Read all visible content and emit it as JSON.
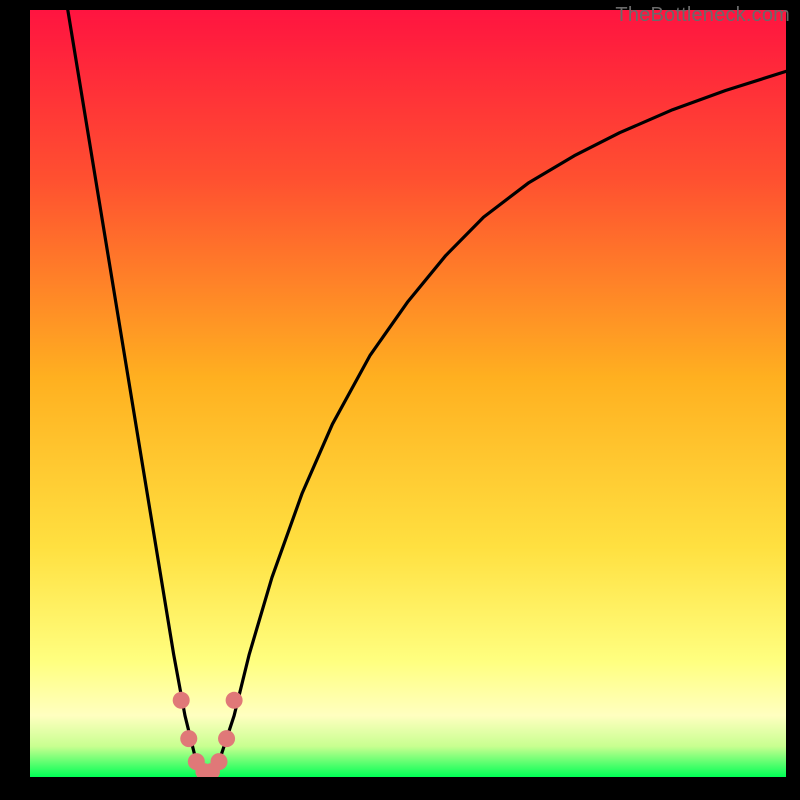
{
  "watermark": "TheBottleneck.com",
  "colors": {
    "frame": "#000000",
    "gradient_top": "#ff1440",
    "gradient_upper": "#ff5030",
    "gradient_mid": "#ffb020",
    "gradient_lower": "#ffe040",
    "gradient_near_bottom": "#ffff80",
    "gradient_bottom": "#00ff55",
    "curve": "#000000",
    "marker": "#e07878"
  },
  "chart_data": {
    "type": "line",
    "title": "",
    "xlabel": "",
    "ylabel": "",
    "xlim": [
      0,
      100
    ],
    "ylim": [
      0,
      100
    ],
    "curve": {
      "name": "bottleneck-curve",
      "x": [
        5,
        7,
        9,
        11,
        13,
        15,
        17,
        19,
        20.5,
        22,
        23.5,
        25,
        27,
        29,
        32,
        36,
        40,
        45,
        50,
        55,
        60,
        66,
        72,
        78,
        85,
        92,
        100
      ],
      "y": [
        100,
        88,
        76,
        64,
        52,
        40,
        28,
        16,
        8,
        2,
        0.5,
        2,
        8,
        16,
        26,
        37,
        46,
        55,
        62,
        68,
        73,
        77.5,
        81,
        84,
        87,
        89.5,
        92
      ]
    },
    "markers": {
      "name": "highlight-points",
      "x": [
        20,
        21,
        22,
        23,
        24,
        25,
        26,
        27
      ],
      "y": [
        10,
        5,
        2,
        0.7,
        0.7,
        2,
        5,
        10
      ]
    },
    "min_point": {
      "x": 23.5,
      "y": 0.5
    }
  }
}
